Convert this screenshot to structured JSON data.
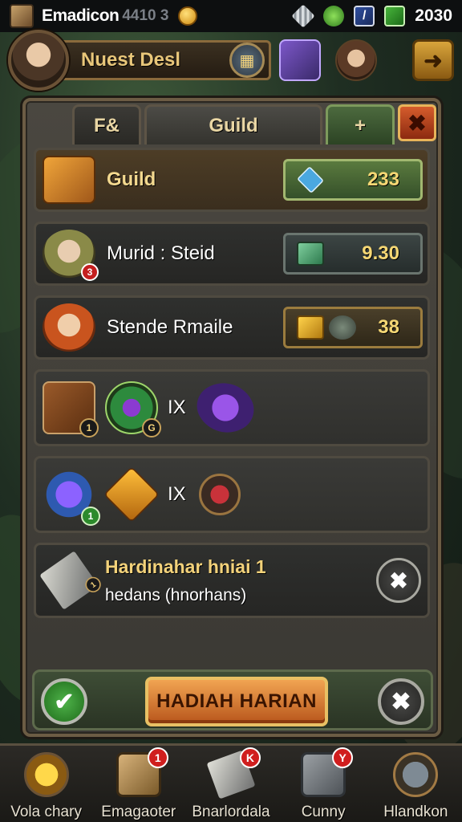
{
  "status_bar": {
    "title": "Emadicon",
    "ghost_text": "4410 3",
    "year": "2030",
    "icons": [
      "app-logo-icon",
      "gold-gem-icon",
      "quests-diamond-icon",
      "green-leaf-icon",
      "blue-card-icon",
      "green-book-icon"
    ]
  },
  "header": {
    "quest_title": "Nuest Desl",
    "quest_button_icon": "shield-crest-icon",
    "icons": [
      "hero-portrait-icon",
      "magic-wand-icon",
      "ally-portrait-icon",
      "arrow-forward-icon"
    ]
  },
  "tabs": [
    {
      "label": "F&"
    },
    {
      "label": "Guild"
    },
    {
      "label": "+"
    }
  ],
  "rows": [
    {
      "label": "Guild",
      "icon": "treasure-chest-icon",
      "value": "233",
      "value_icon": "blue-diamond-icon"
    },
    {
      "label": "Murid : Steid",
      "icon": "elf-portrait-icon",
      "badge": "3",
      "value": "9.30",
      "value_icon": "jade-cube-icon"
    },
    {
      "label": "Stende Rmaile",
      "icon": "redhead-portrait-icon",
      "value": "38",
      "value_icon": "gold-box-icon"
    }
  ],
  "reward_rows": [
    {
      "items": [
        "spear-icon",
        "emerald-shield-icon",
        "amethyst-amulet-icon"
      ],
      "times": "IX",
      "badges": [
        "1",
        "G"
      ]
    },
    {
      "items": [
        "violet-orb-icon",
        "gold-cube-icon",
        "ruby-token-icon"
      ],
      "times": "IX",
      "badges": [
        "1"
      ]
    }
  ],
  "daily": {
    "title": "Hardinahar hniai  1",
    "subtitle": "hedans (hnorhans)",
    "badge": "1",
    "icon": "crossed-sword-icon"
  },
  "actions": {
    "claim_label": "HADIAH HARIAN",
    "confirm_icon": "check-icon",
    "cancel_icon": "close-icon"
  },
  "nav": [
    {
      "label": "Vola chary",
      "icon": "star-icon"
    },
    {
      "label": "Emagaoter",
      "icon": "scroll-icon",
      "badge": "1"
    },
    {
      "label": "Bnarlordala",
      "icon": "blade-icon",
      "badge": "K"
    },
    {
      "label": "Cunny",
      "icon": "book-icon",
      "badge": "Y"
    },
    {
      "label": "Hlandkon",
      "icon": "magnifier-icon"
    }
  ]
}
